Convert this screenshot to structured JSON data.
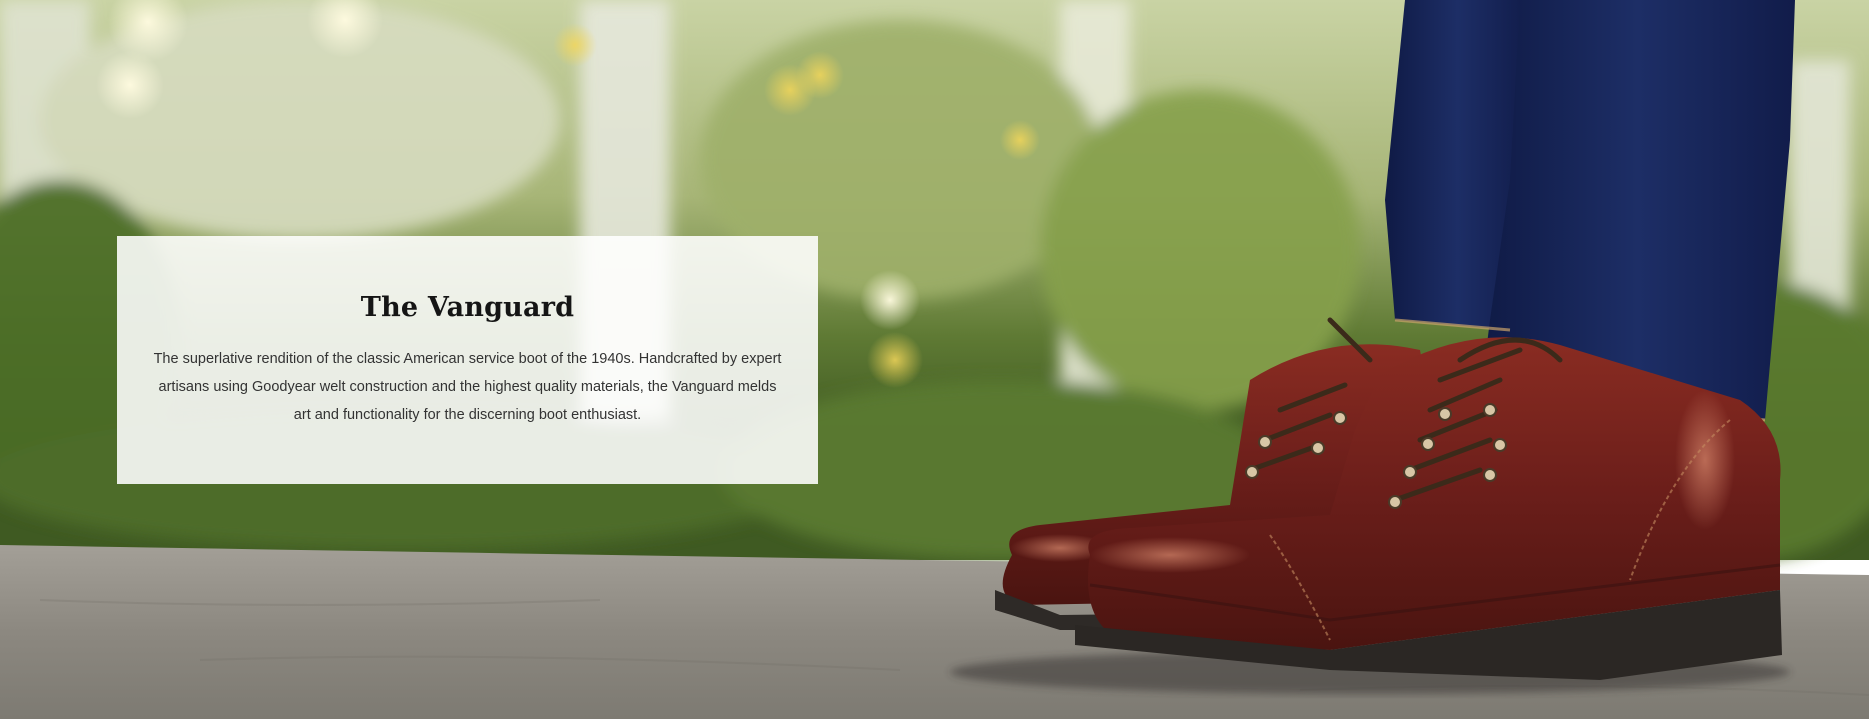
{
  "hero": {
    "image_description_icon": "boots-photo-icon"
  },
  "card": {
    "title": "The Vanguard",
    "description": "The superlative rendition of the classic American service boot of the 1940s. Handcrafted by expert artisans using Goodyear welt construction and the highest quality materials, the Vanguard melds art and functionality for the discerning boot enthusiast."
  },
  "colors": {
    "card_bg": "#FFFFFF",
    "title": "#151515",
    "text": "#333333",
    "leather": "#6B1E1A",
    "denim": "#1A2A5C",
    "foliage": "#6F8A3A",
    "stone": "#9A958C"
  }
}
